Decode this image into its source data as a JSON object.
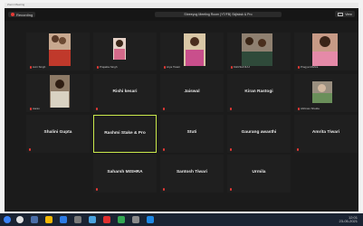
{
  "window": {
    "title": "Zoom Meeting"
  },
  "topbar": {
    "recording_label": "Recording",
    "meeting_title": "Shreeyog Meeting Room (YT/FB) Skjlsksk & Pro",
    "view_label": "View"
  },
  "participants": [
    {
      "id": "p1",
      "display": "",
      "tag": "Avni Singh",
      "video": true
    },
    {
      "id": "p2",
      "display": "",
      "tag": "Prajakta Singh",
      "video": true
    },
    {
      "id": "p3",
      "display": "",
      "tag": "Arya Tiwari",
      "video": true
    },
    {
      "id": "p4",
      "display": "",
      "tag": "KHUSHI RAJ",
      "video": true
    },
    {
      "id": "p5",
      "display": "",
      "tag": "Pragya Mishra",
      "video": true
    },
    {
      "id": "p6",
      "display": "",
      "tag": "Aarav",
      "video": true
    },
    {
      "id": "p7",
      "display": "Rishi kesari",
      "tag": "",
      "video": false
    },
    {
      "id": "p8",
      "display": "Jaiswal",
      "tag": "",
      "video": false
    },
    {
      "id": "p9",
      "display": "Kiran Rastogi",
      "tag": "",
      "video": false
    },
    {
      "id": "p10",
      "display": "",
      "tag": "Abhinav Shukla",
      "video": true
    },
    {
      "id": "p11",
      "display": "Shalini Gupta",
      "tag": "",
      "video": false
    },
    {
      "id": "p12",
      "display": "Rashmi Stake & Pro",
      "tag": "",
      "video": false,
      "speaking": true
    },
    {
      "id": "p13",
      "display": "Stuti",
      "tag": "",
      "video": false
    },
    {
      "id": "p14",
      "display": "Gaurang awasthi",
      "tag": "",
      "video": false
    },
    {
      "id": "p15",
      "display": "Amrita Tiwari",
      "tag": "",
      "video": false
    },
    {
      "id": "p16",
      "display": "Saharsh MISHRA",
      "tag": "",
      "video": false
    },
    {
      "id": "p17",
      "display": "Santosh Tiwari",
      "tag": "",
      "video": false
    },
    {
      "id": "p18",
      "display": "Urmila",
      "tag": "",
      "video": false
    }
  ],
  "taskbar": {
    "time": "12:01",
    "date": "23-05-2021"
  },
  "colors": {
    "background": "#1b1b1b",
    "tile": "#1f1f1f",
    "speaking_border": "#c9e84b",
    "muted": "#e53935"
  }
}
